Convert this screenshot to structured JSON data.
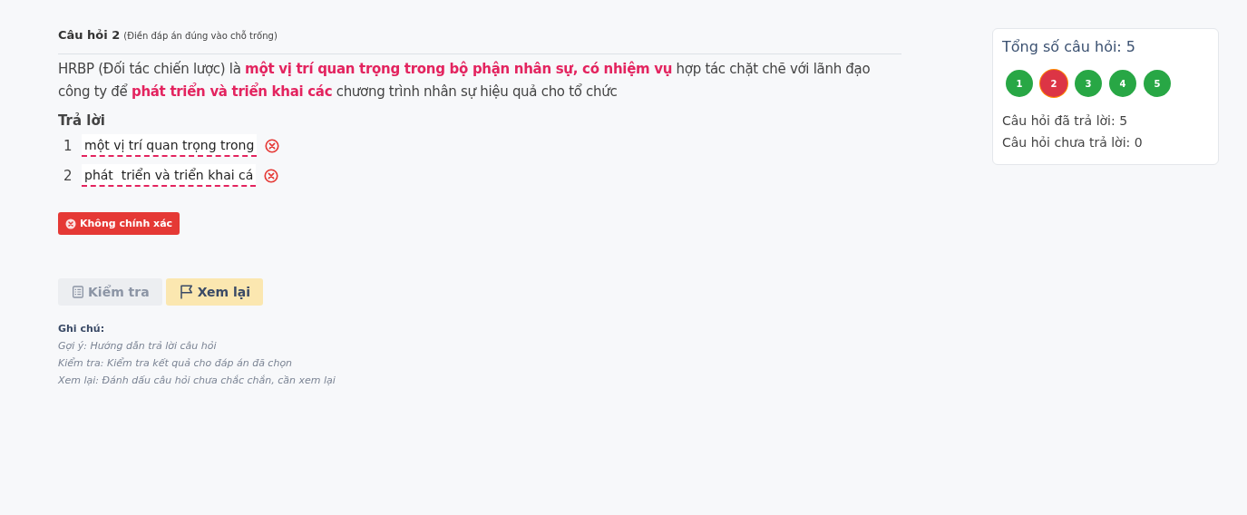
{
  "question": {
    "title": "Câu hỏi 2",
    "hint": "(Điền đáp án đúng vào chỗ trống)",
    "text": "HRBP (Đối tác chiến lược) là **một vị trí quan trọng trong bộ phận nhân sự, có nhiệm vụ** hợp tác chặt chẽ với lãnh đạo công ty để **phát triển và triển khai các** chương trình nhân sự hiệu quả cho tổ chức"
  },
  "answer": {
    "label": "Trả lời",
    "blanks": [
      {
        "number": "1",
        "value": "một vị trí quan trọng trong",
        "correct": false
      },
      {
        "number": "2",
        "value": "phát  triển và triển khai cá",
        "correct": false
      }
    ],
    "result": {
      "kind": "incorrect",
      "label": "Không chính xác"
    }
  },
  "buttons": [
    {
      "kind": "check",
      "label": "Kiểm tra",
      "disabled": true
    },
    {
      "kind": "review",
      "label": "Xem lại",
      "disabled": false
    }
  ],
  "notes": {
    "title": "Ghi chú:",
    "lines": [
      "Gợi ý: Hướng dẫn trả lời câu hỏi",
      "Kiểm tra: Kiểm tra kết quả cho đáp án đã chọn",
      "Xem lại: Đánh dấu câu hỏi chưa chắc chắn, cần xem lại"
    ]
  },
  "summary": {
    "title": "Tổng số câu hỏi: 5",
    "questions": [
      {
        "label": "1",
        "color": "#28a745",
        "selected": false
      },
      {
        "label": "2",
        "color": "#dc3545",
        "selected": true
      },
      {
        "label": "3",
        "color": "#28a745",
        "selected": false
      },
      {
        "label": "4",
        "color": "#28a745",
        "selected": false
      },
      {
        "label": "5",
        "color": "#28a745",
        "selected": false
      }
    ],
    "answered": "Câu hỏi đã trả lời: 5",
    "unanswered": "Câu hỏi chưa trả lời: 0"
  }
}
